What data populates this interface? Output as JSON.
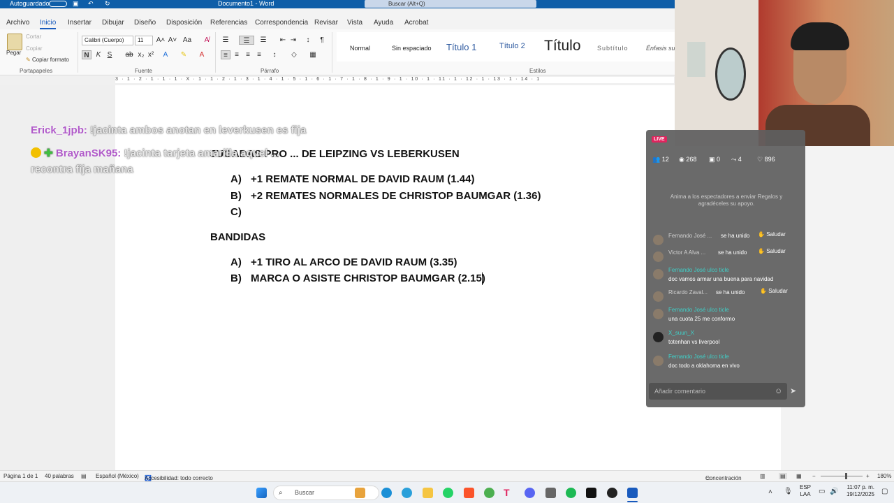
{
  "titlebar": {
    "autosave": "Autoguardado",
    "doc": "Documento1 - Word",
    "search": "Buscar (Alt+Q)"
  },
  "menu": [
    "Archivo",
    "Inicio",
    "Insertar",
    "Dibujar",
    "Diseño",
    "Disposición",
    "Referencias",
    "Correspondencia",
    "Revisar",
    "Vista",
    "Ayuda",
    "Acrobat"
  ],
  "ribbon": {
    "clipboard": {
      "paste": "Pegar",
      "cut": "Cortar",
      "copy": "Copiar",
      "format": "Copiar formato",
      "label": "Portapapeles"
    },
    "font": {
      "name": "Calibri (Cuerpo)",
      "size": "11",
      "label": "Fuente"
    },
    "paragraph": {
      "label": "Párrafo"
    },
    "styles": {
      "label": "Estilos",
      "items": [
        "Normal",
        "Sin espaciado",
        "Título 1",
        "Título 2",
        "Título",
        "Subtítulo",
        "Énfasis su"
      ]
    }
  },
  "ruler": {
    "left": "3 · 1 · 2 · 1 · 1 · 1 · X · 1 · 1 · 2 · 1 · 3 · 1 · 4 · 1 · 5 · 1 · 6 · 1 · 7 · 1 · 8 · 1 · 9 · 1 · 10 · 1 · 11 · 1 · 12 · 1 · 13 · 1 · 14 · 1"
  },
  "document": {
    "heading1": "JUGADAS PRO ... DE LEIPZING VS LEBERKUSEN",
    "heading1_tail": "E LEIPZING VS LEBERKUSEN",
    "list1": [
      {
        "letter": "A)",
        "text": "+1 REMATE NORMAL DE DAVID RAUM (1.44)"
      },
      {
        "letter": "B)",
        "text": "+2 REMATES NORMALES DE CHRISTOP BAUMGAR (1.36)"
      },
      {
        "letter": "C)",
        "text": ""
      }
    ],
    "heading2": "BANDIDAS",
    "list2": [
      {
        "letter": "A)",
        "text": "+1 TIRO AL ARCO DE DAVID RAUM (3.35)"
      },
      {
        "letter": "B)",
        "text": "MARCA O ASISTE CHRISTOP BAUMGAR (2.15)"
      }
    ]
  },
  "overlay": {
    "c1_user": "Erick_1jpb:",
    "c1_text": "!jacinta ambos anotan en leverkusen es fija",
    "c2_user": "BrayanSK95:",
    "c2_text": "!jacinta tarjeta amarilla aquel ...",
    "c2_text2": "recontra fija mañana"
  },
  "live": {
    "badge": "LIVE",
    "stats": {
      "viewers": "12",
      "views": "268",
      "gifts": "0",
      "shares": "4",
      "likes": "896"
    },
    "invite": "Anima a los espectadores a enviar Regalos y agradéceles su apoyo.",
    "comments": [
      {
        "name": "Fernando José ...",
        "joined": "se ha unido",
        "greet": "Saludar"
      },
      {
        "name": "Victor A Alva ...",
        "joined": "se ha unido",
        "greet": "Saludar"
      },
      {
        "name": "Fernando José ulco ticle",
        "text": "doc vamos armar una buena para navidad"
      },
      {
        "name": "Ricardo Zaval...",
        "joined": "se ha unido",
        "greet": "Saludar"
      },
      {
        "name": "Fernando José ulco ticle",
        "text": "una cuota 25 me conformo"
      },
      {
        "name": "X_suun_X",
        "text": "totenhan vs liverpool"
      },
      {
        "name": "Fernando José ulco ticle",
        "text": "doc todo a oklahoma en vivo"
      }
    ],
    "input_placeholder": "Añadir comentario"
  },
  "statusbar": {
    "page": "Página 1 de 1",
    "words": "40 palabras",
    "lang": "Español (México)",
    "access": "Accesibilidad: todo correcto",
    "focus": "Concentración",
    "zoom": "180%"
  },
  "taskbar": {
    "search": "Buscar",
    "lang1": "ESP",
    "lang2": "LAA",
    "time": "11:07 p. m.",
    "date": "19/12/2025"
  }
}
